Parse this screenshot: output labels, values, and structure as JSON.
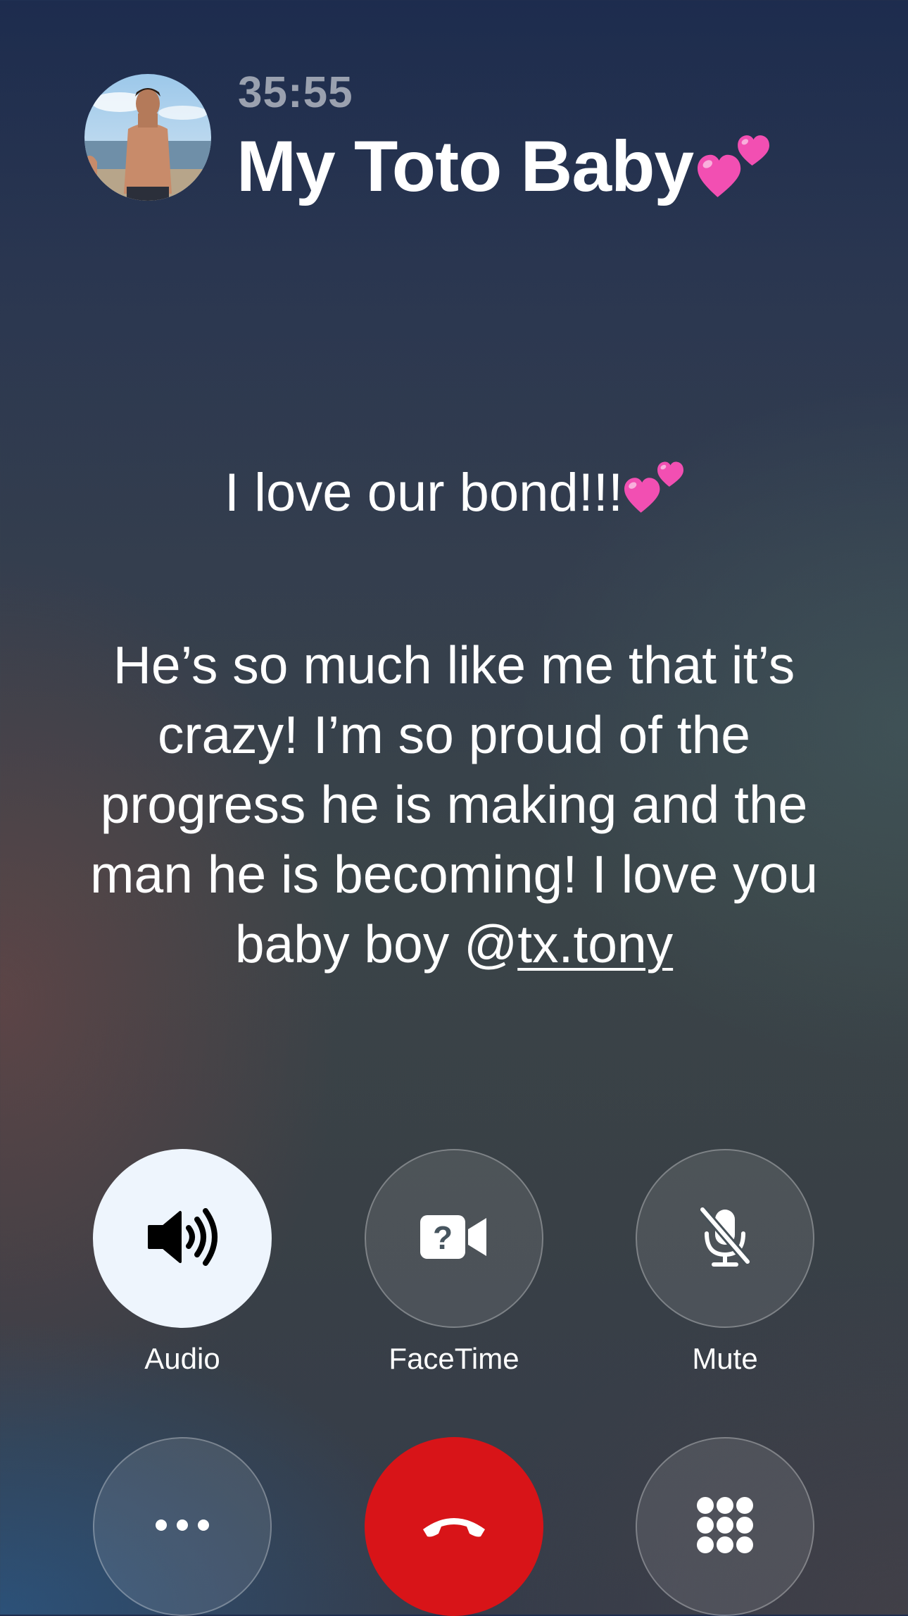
{
  "call": {
    "timer": "35:55",
    "contact_name": "My Toto Baby"
  },
  "caption": {
    "line1": "I love our bond!!!",
    "body": "He’s so much like me that it’s crazy! I’m so proud of the progress he is making and the man he is becoming! I love you baby boy ",
    "mention_at": "@",
    "mention_handle": "tx.tony"
  },
  "controls": {
    "audio_label": "Audio",
    "facetime_label": "FaceTime",
    "mute_label": "Mute"
  },
  "colors": {
    "end_call": "#d81418",
    "audio_button": "#eef5fd",
    "hearts": "#f24fb2"
  },
  "icons": [
    "two-hearts-icon",
    "speaker-icon",
    "facetime-unavailable-icon",
    "mic-off-icon",
    "more-icon",
    "end-call-icon",
    "keypad-icon"
  ]
}
